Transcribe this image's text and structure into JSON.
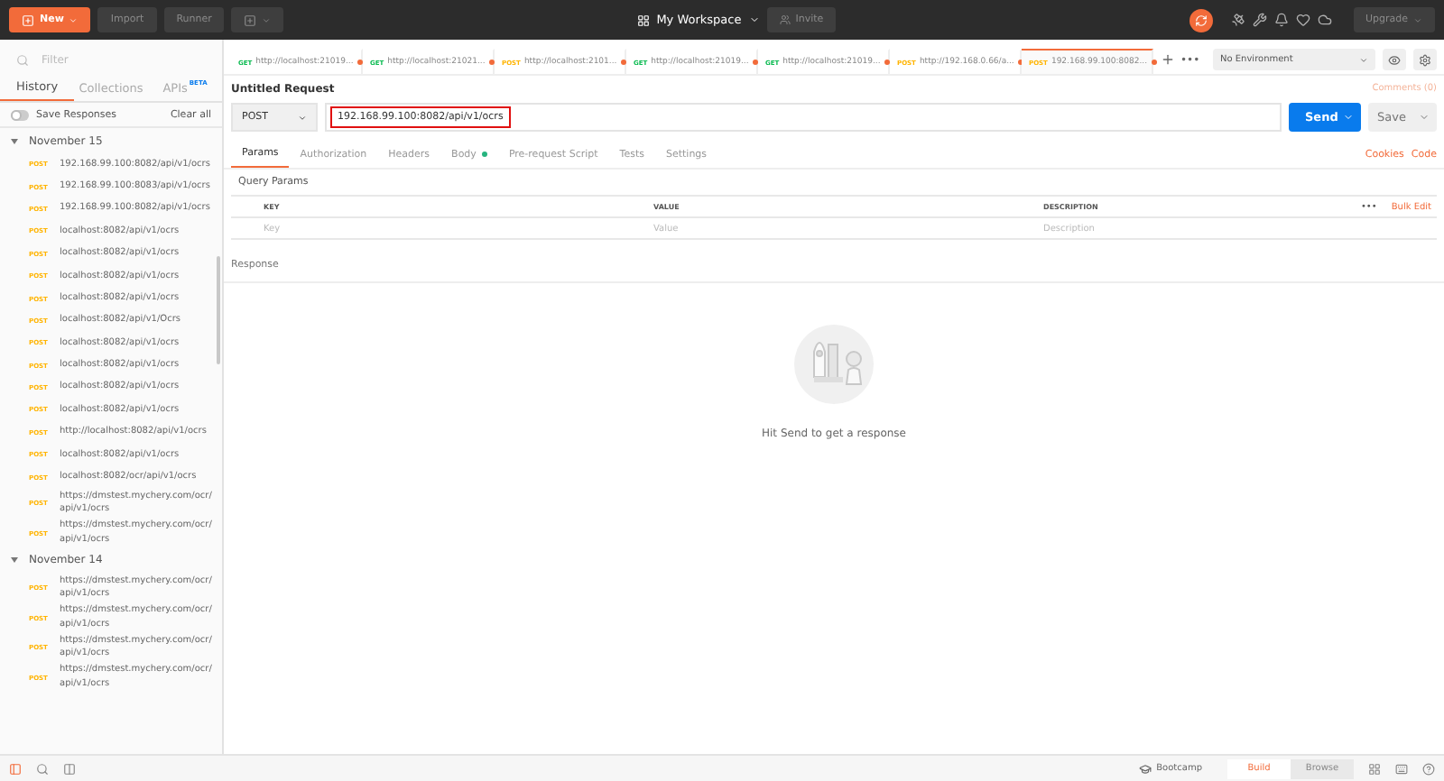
{
  "header": {
    "new_button": "New",
    "import_button": "Import",
    "runner_button": "Runner",
    "workspace": "My Workspace",
    "invite_button": "Invite",
    "upgrade_button": "Upgrade"
  },
  "sidebar": {
    "filter_placeholder": "Filter",
    "tabs": [
      {
        "label": "History",
        "selected": true
      },
      {
        "label": "Collections",
        "selected": false
      },
      {
        "label": "APIs",
        "badge": "BETA",
        "selected": false
      }
    ],
    "save_responses": {
      "label": "Save Responses",
      "on": false
    },
    "clear_all": "Clear all",
    "groups": [
      {
        "title": "November 15",
        "expanded": true,
        "items": [
          {
            "method": "POST",
            "url": "192.168.99.100:8082/api/v1/ocrs"
          },
          {
            "method": "POST",
            "url": "192.168.99.100:8083/api/v1/ocrs"
          },
          {
            "method": "POST",
            "url": "192.168.99.100:8082/api/v1/ocrs"
          },
          {
            "method": "POST",
            "url": "localhost:8082/api/v1/ocrs"
          },
          {
            "method": "POST",
            "url": "localhost:8082/api/v1/ocrs"
          },
          {
            "method": "POST",
            "url": "localhost:8082/api/v1/ocrs"
          },
          {
            "method": "POST",
            "url": "localhost:8082/api/v1/ocrs"
          },
          {
            "method": "POST",
            "url": "localhost:8082/api/v1/Ocrs"
          },
          {
            "method": "POST",
            "url": "localhost:8082/api/v1/ocrs"
          },
          {
            "method": "POST",
            "url": "localhost:8082/api/v1/ocrs"
          },
          {
            "method": "POST",
            "url": "localhost:8082/api/v1/ocrs"
          },
          {
            "method": "POST",
            "url": "localhost:8082/api/v1/ocrs"
          },
          {
            "method": "POST",
            "url": "http://localhost:8082/api/v1/ocrs"
          },
          {
            "method": "POST",
            "url": "localhost:8082/api/v1/ocrs"
          },
          {
            "method": "POST",
            "url": "localhost:8082/ocr/api/v1/ocrs"
          },
          {
            "method": "POST",
            "url": "https://dmstest.mychery.com/ocr/api/v1/ocrs"
          },
          {
            "method": "POST",
            "url": "https://dmstest.mychery.com/ocr/api/v1/ocrs"
          }
        ]
      },
      {
        "title": "November 14",
        "expanded": true,
        "items": [
          {
            "method": "POST",
            "url": "https://dmstest.mychery.com/ocr/api/v1/ocrs"
          },
          {
            "method": "POST",
            "url": "https://dmstest.mychery.com/ocr/api/v1/ocrs"
          },
          {
            "method": "POST",
            "url": "https://dmstest.mychery.com/ocr/api/v1/ocrs"
          },
          {
            "method": "POST",
            "url": "https://dmstest.mychery.com/ocr/api/v1/ocrs"
          }
        ]
      }
    ]
  },
  "request_tabs": [
    {
      "method": "GET",
      "label": "http://localhost:21019...",
      "unsaved": true,
      "selected": false
    },
    {
      "method": "GET",
      "label": "http://localhost:21021...",
      "unsaved": true,
      "selected": false
    },
    {
      "method": "POST",
      "label": "http://localhost:2101...",
      "unsaved": true,
      "selected": false
    },
    {
      "method": "GET",
      "label": "http://localhost:21019...",
      "unsaved": true,
      "selected": false
    },
    {
      "method": "GET",
      "label": "http://localhost:21019...",
      "unsaved": true,
      "selected": false
    },
    {
      "method": "POST",
      "label": "http://192.168.0.66/a...",
      "unsaved": true,
      "selected": false
    },
    {
      "method": "POST",
      "label": "192.168.99.100:8082...",
      "unsaved": true,
      "selected": true
    }
  ],
  "more_tabs": "•••",
  "environment": "No Environment",
  "request": {
    "title": "Untitled Request",
    "comments": "Comments (0)",
    "method": "POST",
    "url": "192.168.99.100:8082/api/v1/ocrs",
    "url_highlighted": true,
    "send_button": "Send",
    "save_button": "Save"
  },
  "param_tabs": [
    {
      "label": "Params",
      "selected": true
    },
    {
      "label": "Authorization",
      "selected": false
    },
    {
      "label": "Headers",
      "selected": false
    },
    {
      "label": "Body",
      "selected": false,
      "has_content": true
    },
    {
      "label": "Pre-request Script",
      "selected": false
    },
    {
      "label": "Tests",
      "selected": false
    },
    {
      "label": "Settings",
      "selected": false
    }
  ],
  "cookies_link": "Cookies",
  "code_link": "Code",
  "query_params": {
    "title": "Query Params",
    "columns": [
      "KEY",
      "VALUE",
      "DESCRIPTION"
    ],
    "more": "•••",
    "bulk_edit": "Bulk Edit",
    "placeholders": [
      "Key",
      "Value",
      "Description"
    ]
  },
  "response": {
    "title": "Response",
    "empty_message": "Hit Send to get a response"
  },
  "status_bar": {
    "bootcamp": "Bootcamp",
    "modes": [
      {
        "label": "Build",
        "selected": true
      },
      {
        "label": "Browse",
        "selected": false
      }
    ]
  }
}
